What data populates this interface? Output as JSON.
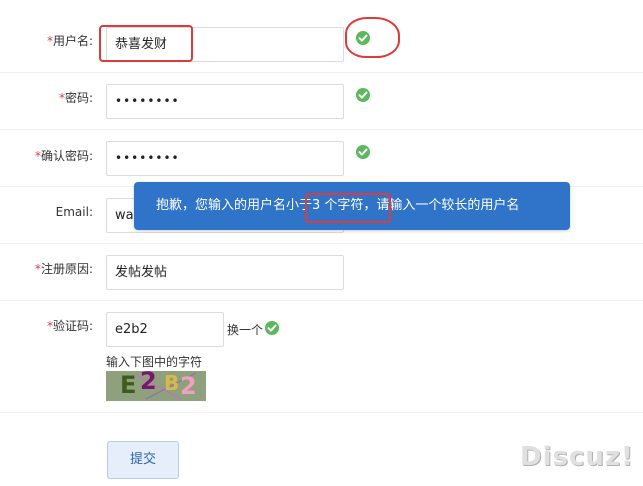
{
  "form": {
    "username": {
      "required_mark": "*",
      "label": "用户名:",
      "value": "恭喜发财"
    },
    "password": {
      "required_mark": "*",
      "label": "密码:",
      "value": "••••••••"
    },
    "confirm_password": {
      "required_mark": "*",
      "label": "确认密码:",
      "value": "••••••••"
    },
    "email": {
      "label": "Email:",
      "value": "wa"
    },
    "reason": {
      "required_mark": "*",
      "label": "注册原因:",
      "value": "发帖发帖"
    },
    "captcha": {
      "required_mark": "*",
      "label": "验证码:",
      "value": "e2b2",
      "refresh_label": "换一个",
      "hint": "输入下图中的字符",
      "image_chars": [
        "E",
        "2",
        "B",
        "2"
      ]
    },
    "submit_label": "提交"
  },
  "tooltip": {
    "text_before": "抱歉，您输入的用户名小于",
    "text_highlight": "3 个字符",
    "text_after": "，请输入一个较长的用户名"
  },
  "watermark": "Discuz!",
  "colors": {
    "success": "#5cb85c",
    "tooltip_bg": "#2f74c9",
    "required": "#e4393c",
    "annotation": "#e03a3a"
  },
  "icons": [
    "check-icon"
  ]
}
